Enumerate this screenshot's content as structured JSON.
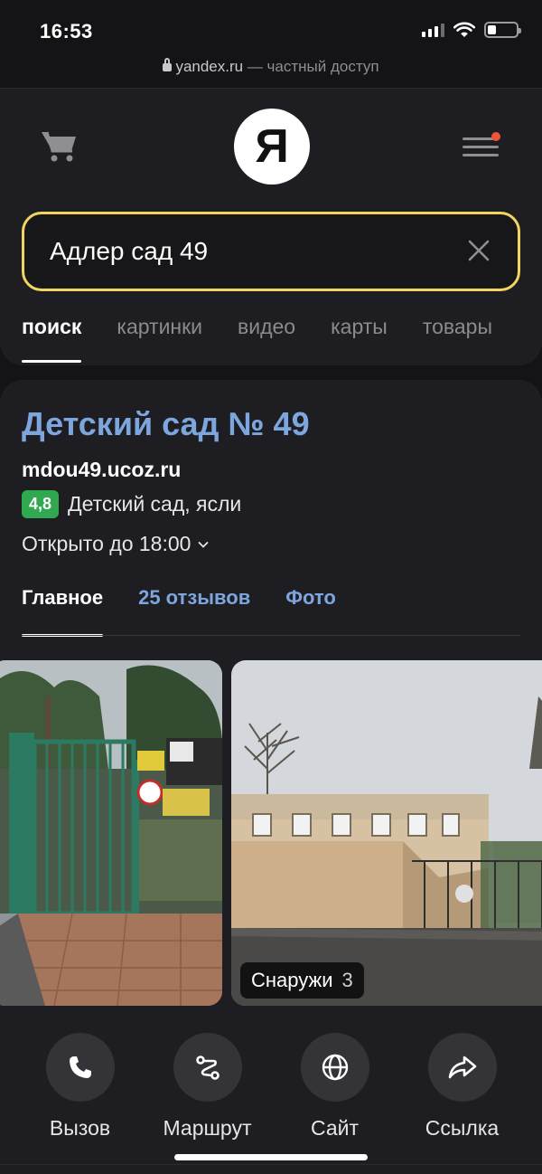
{
  "status": {
    "time": "16:53"
  },
  "browser": {
    "domain": "yandex.ru",
    "access_note": " — частный доступ"
  },
  "header": {
    "logo_text": "Я"
  },
  "search": {
    "value": "Адлер сад 49"
  },
  "tabs": [
    {
      "label": "поиск",
      "active": true
    },
    {
      "label": "картинки"
    },
    {
      "label": "видео"
    },
    {
      "label": "карты"
    },
    {
      "label": "товары"
    }
  ],
  "result": {
    "title": "Детский сад № 49",
    "domain": "mdou49.ucoz.ru",
    "rating": "4,8",
    "category": "Детский сад, ясли",
    "hours": "Открыто до 18:00",
    "tabs": [
      {
        "label": "Главное",
        "active": true
      },
      {
        "label": "25 отзывов"
      },
      {
        "label": "Фото"
      }
    ],
    "photo_caption": {
      "label": "Снаружи",
      "count": "3"
    },
    "actions": [
      {
        "label": "Вызов",
        "icon": "phone-icon"
      },
      {
        "label": "Маршрут",
        "icon": "route-icon"
      },
      {
        "label": "Сайт",
        "icon": "globe-icon"
      },
      {
        "label": "Ссылка",
        "icon": "share-icon"
      }
    ]
  },
  "colors": {
    "accent_link": "#7ea6de",
    "search_border": "#f1d560",
    "rating_green": "#2fa84f",
    "notification_dot": "#f0523b"
  }
}
